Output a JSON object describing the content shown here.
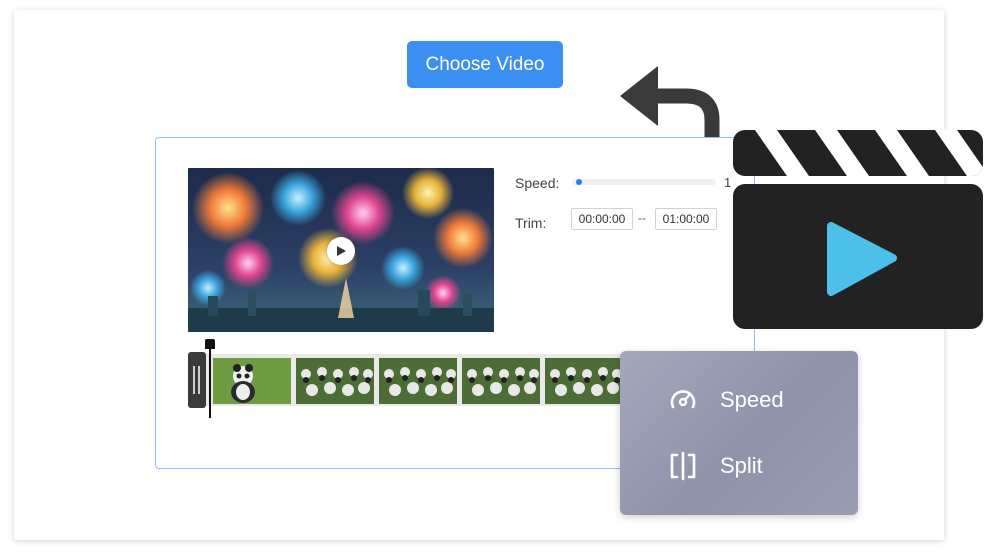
{
  "header": {
    "choose_button_label": "Choose Video"
  },
  "editor": {
    "speed_label": "Speed:",
    "speed_value": "1",
    "speed_level_fraction": 0.03,
    "trim_label": "Trim:",
    "trim_start": "00:00:00",
    "trim_separator": "--",
    "trim_end": "01:00:00"
  },
  "context_menu": {
    "items": [
      {
        "label": "Speed",
        "icon": "gauge-icon"
      },
      {
        "label": "Split",
        "icon": "split-icon"
      }
    ]
  },
  "colors": {
    "accent": "#3b8ff0",
    "editor_border": "#8fbff1",
    "clapper_body": "#222222",
    "clapper_play": "#4dc0ea",
    "menu_bg": "#9a9eb3"
  }
}
